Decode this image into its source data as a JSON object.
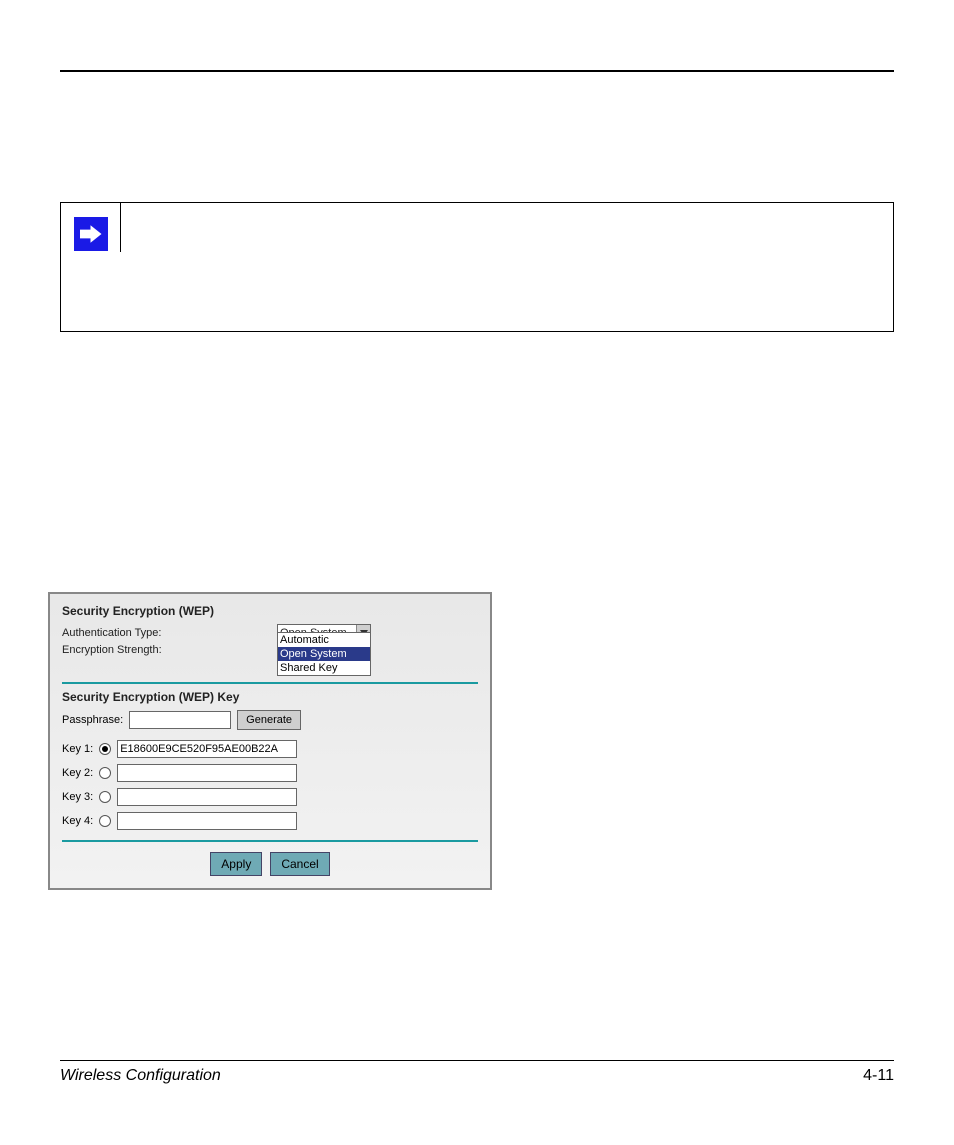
{
  "footer": {
    "section": "Wireless Configuration",
    "page": "4-11"
  },
  "note": {
    "body": ""
  },
  "panel": {
    "heading1": "Security Encryption (WEP)",
    "auth_label": "Authentication Type:",
    "strength_label": "Encryption Strength:",
    "auth_selected": "Open System",
    "auth_options": [
      "Automatic",
      "Open System",
      "Shared Key"
    ],
    "auth_highlight_index": 1,
    "heading2": "Security Encryption (WEP) Key",
    "passphrase_label": "Passphrase:",
    "passphrase_value": "",
    "generate_label": "Generate",
    "keys": [
      {
        "label": "Key 1:",
        "value": "E18600E9CE520F95AE00B22A",
        "selected": true
      },
      {
        "label": "Key 2:",
        "value": "",
        "selected": false
      },
      {
        "label": "Key 3:",
        "value": "",
        "selected": false
      },
      {
        "label": "Key 4:",
        "value": "",
        "selected": false
      }
    ],
    "apply_label": "Apply",
    "cancel_label": "Cancel"
  }
}
